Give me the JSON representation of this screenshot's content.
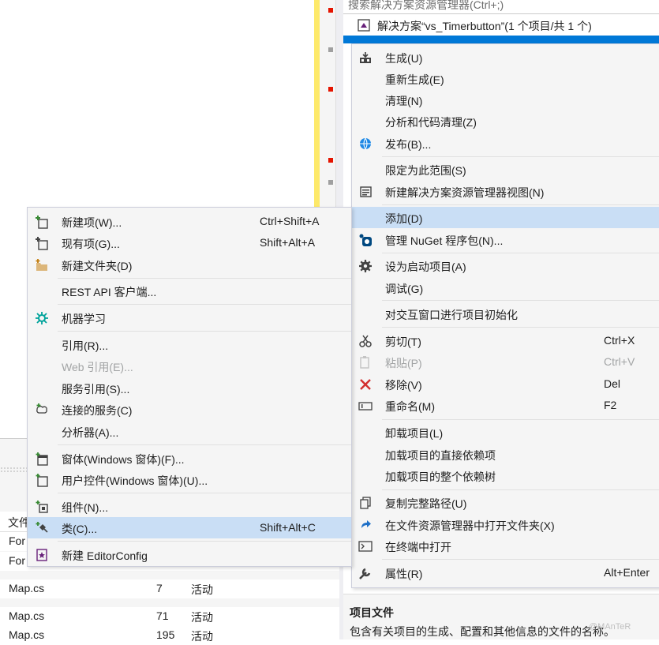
{
  "solution_explorer": {
    "search_placeholder": "搜索解决方案资源管理器(Ctrl+;)",
    "solution_label": "解决方案“vs_Timerbutton”(1 个项目/共 1 个)",
    "description_title": "项目文件",
    "description_text": "包含有关项目的生成、配置和其他信息的文件的名称。"
  },
  "bottom_panel": {
    "column_header": "文件",
    "rows": [
      {
        "file": "For",
        "line": "",
        "status": ""
      },
      {
        "file": "For",
        "line": "",
        "status": ""
      },
      {
        "file": "Map.cs",
        "line": "7",
        "status": "活动"
      },
      {
        "file": "Map.cs",
        "line": "71",
        "status": "活动"
      },
      {
        "file": "Map.cs",
        "line": "195",
        "status": "活动"
      }
    ]
  },
  "main_menu": {
    "items": [
      {
        "label": "生成(U)",
        "shortcut": "",
        "icon": "build-icon"
      },
      {
        "label": "重新生成(E)",
        "shortcut": "",
        "icon": ""
      },
      {
        "label": "清理(N)",
        "shortcut": "",
        "icon": ""
      },
      {
        "label": "分析和代码清理(Z)",
        "shortcut": "",
        "icon": ""
      },
      {
        "label": "发布(B)...",
        "shortcut": "",
        "icon": "globe-icon"
      },
      {
        "label": "限定为此范围(S)",
        "shortcut": "",
        "icon": ""
      },
      {
        "label": "新建解决方案资源管理器视图(N)",
        "shortcut": "",
        "icon": "new-view-icon"
      },
      {
        "label": "添加(D)",
        "shortcut": "",
        "icon": ""
      },
      {
        "label": "管理 NuGet 程序包(N)...",
        "shortcut": "",
        "icon": "nuget-icon"
      },
      {
        "label": "设为启动项目(A)",
        "shortcut": "",
        "icon": "gear-icon"
      },
      {
        "label": "调试(G)",
        "shortcut": "",
        "icon": ""
      },
      {
        "label": "对交互窗口进行项目初始化",
        "shortcut": "",
        "icon": ""
      },
      {
        "label": "剪切(T)",
        "shortcut": "Ctrl+X",
        "icon": "scissors-icon"
      },
      {
        "label": "粘贴(P)",
        "shortcut": "Ctrl+V",
        "icon": "paste-icon"
      },
      {
        "label": "移除(V)",
        "shortcut": "Del",
        "icon": "remove-icon"
      },
      {
        "label": "重命名(M)",
        "shortcut": "F2",
        "icon": "rename-icon"
      },
      {
        "label": "卸载项目(L)",
        "shortcut": "",
        "icon": ""
      },
      {
        "label": "加载项目的直接依赖项",
        "shortcut": "",
        "icon": ""
      },
      {
        "label": "加载项目的整个依赖树",
        "shortcut": "",
        "icon": ""
      },
      {
        "label": "复制完整路径(U)",
        "shortcut": "",
        "icon": "copy-icon"
      },
      {
        "label": "在文件资源管理器中打开文件夹(X)",
        "shortcut": "",
        "icon": "refresh-arrow-icon"
      },
      {
        "label": "在终端中打开",
        "shortcut": "",
        "icon": "terminal-icon"
      },
      {
        "label": "属性(R)",
        "shortcut": "Alt+Enter",
        "icon": "wrench-icon"
      }
    ]
  },
  "add_menu": {
    "items": [
      {
        "label": "新建项(W)...",
        "shortcut": "Ctrl+Shift+A",
        "icon": "new-item-icon"
      },
      {
        "label": "现有项(G)...",
        "shortcut": "Shift+Alt+A",
        "icon": "existing-item-icon"
      },
      {
        "label": "新建文件夹(D)",
        "shortcut": "",
        "icon": "new-folder-icon"
      },
      {
        "label": "REST API 客户端...",
        "shortcut": "",
        "icon": ""
      },
      {
        "label": "机器学习",
        "shortcut": "",
        "icon": "machine-learning-icon"
      },
      {
        "label": "引用(R)...",
        "shortcut": "",
        "icon": ""
      },
      {
        "label": "Web 引用(E)...",
        "shortcut": "",
        "icon": ""
      },
      {
        "label": "服务引用(S)...",
        "shortcut": "",
        "icon": ""
      },
      {
        "label": "连接的服务(C)",
        "shortcut": "",
        "icon": "connected-service-icon"
      },
      {
        "label": "分析器(A)...",
        "shortcut": "",
        "icon": ""
      },
      {
        "label": "窗体(Windows 窗体)(F)...",
        "shortcut": "",
        "icon": "form-icon"
      },
      {
        "label": "用户控件(Windows 窗体)(U)...",
        "shortcut": "",
        "icon": "user-control-icon"
      },
      {
        "label": "组件(N)...",
        "shortcut": "",
        "icon": "component-icon"
      },
      {
        "label": "类(C)...",
        "shortcut": "Shift+Alt+C",
        "icon": "class-icon"
      },
      {
        "label": "新建 EditorConfig",
        "shortcut": "",
        "icon": "editorconfig-icon"
      }
    ]
  },
  "watermark": "@MAnTeR",
  "colors": {
    "highlight": "#c9def5",
    "selection": "#0078d7",
    "menu_bg": "#f5f5f5",
    "disabled": "#a2a4a5"
  }
}
